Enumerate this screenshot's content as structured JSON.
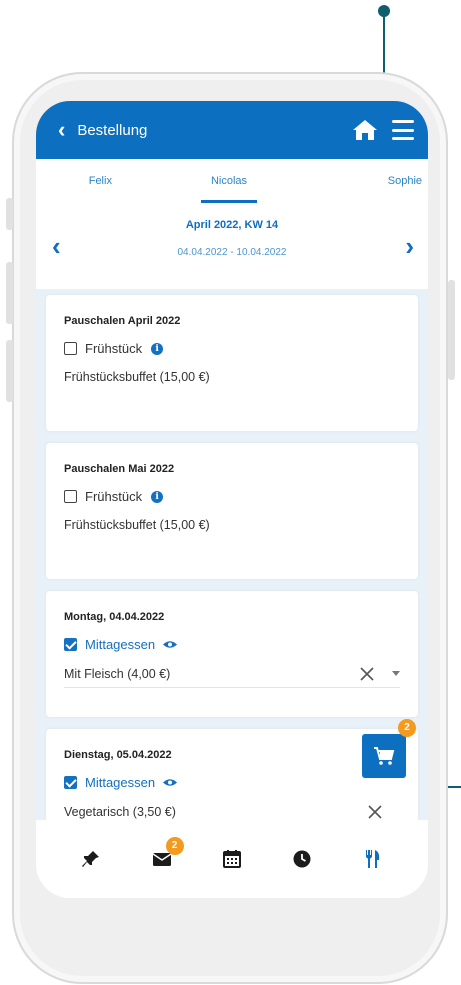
{
  "header": {
    "title": "Bestellung"
  },
  "tabs": [
    {
      "label": "Felix"
    },
    {
      "label": "Nicolas"
    },
    {
      "label": "Sophie"
    }
  ],
  "datenav": {
    "week": "April 2022, KW 14",
    "range": "04.04.2022 - 10.04.2022"
  },
  "cards": [
    {
      "title": "Pauschalen April 2022",
      "option": "Frühstück",
      "checked": false,
      "desc": "Frühstücksbuffet (15,00 €)"
    },
    {
      "title": "Pauschalen Mai 2022",
      "option": "Frühstück",
      "checked": false,
      "desc": "Frühstücksbuffet (15,00 €)"
    },
    {
      "title": "Montag, 04.04.2022",
      "option": "Mittagessen",
      "checked": true,
      "desc": "Mit Fleisch (4,00 €)"
    },
    {
      "title": "Dienstag, 05.04.2022",
      "option": "Mittagessen",
      "checked": true,
      "desc": "Vegetarisch (3,50 €)"
    }
  ],
  "cart": {
    "count": "2"
  },
  "bottomnav": {
    "items": [
      "pin-icon",
      "mail-icon",
      "calendar-icon",
      "clock-icon",
      "cutlery-icon"
    ],
    "mail_badge": "2",
    "active": "cutlery-icon"
  },
  "colors": {
    "primary": "#0d6fbf",
    "badge": "#f39a1f",
    "callout": "#0e5e6f"
  }
}
